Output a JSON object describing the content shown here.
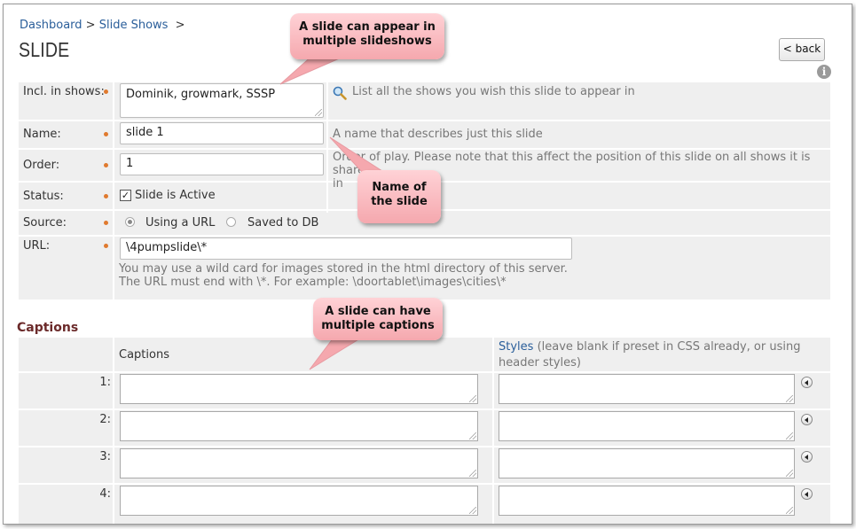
{
  "breadcrumb": {
    "dashboard": "Dashboard",
    "sep1": ">",
    "slide_shows": "Slide Shows",
    "sep2": ">"
  },
  "page_title": "SLIDE",
  "back_label": "< back",
  "info_glyph": "i",
  "form": {
    "incl_label": "Incl. in shows:",
    "incl_value": "Dominik, growmark, SSSP",
    "incl_hint": "List all the shows you wish this slide to appear in",
    "name_label": "Name:",
    "name_value": "slide 1",
    "name_hint": "A name that describes just this slide",
    "order_label": "Order:",
    "order_value": "1",
    "order_hint_line1": "Order of play.  Please note that this affect the position of this slide on all shows it is shared",
    "order_hint_line2": "in",
    "status_label": "Status:",
    "status_check": "✓",
    "status_value": "Slide is Active",
    "source_label": "Source:",
    "source_option1": "Using a URL",
    "source_option2": "Saved to DB",
    "url_label": "URL:",
    "url_value": "\\4pumpslide\\*",
    "url_hint1": "You may use a wild card for images stored in the html directory of this server.",
    "url_hint2": "The URL must end with \\*. For example: \\doortablet\\images\\cities\\*"
  },
  "captions": {
    "heading": "Captions",
    "col_captions": "Captions",
    "col_styles_link": "Styles",
    "col_styles_note1": "(leave blank if preset in CSS already, or using header",
    "col_styles_note2": "styles)",
    "rows": [
      "1:",
      "2:",
      "3:",
      "4:"
    ]
  },
  "callouts": {
    "shows_line1": "A slide can appear in",
    "shows_line2": "multiple slideshows",
    "name_line1": "Name of",
    "name_line2": "the slide",
    "captions_line1": "A slide can have",
    "captions_line2": "multiple captions"
  },
  "colors": {
    "accent": "#e07a2f",
    "link": "#2a5e9a",
    "callout": "#f5a8ae",
    "heading": "#6b2a2a"
  }
}
